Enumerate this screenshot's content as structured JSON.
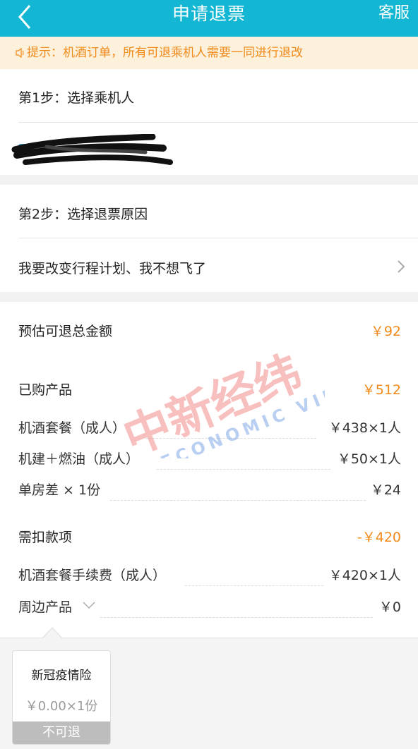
{
  "header": {
    "back_icon": "chevron-left-icon",
    "title": "申请退票",
    "service_label": "客服"
  },
  "notice": {
    "icon": "speaker-icon",
    "text": "提示：机酒订单，所有可退乘机人需要一同进行退改"
  },
  "step1": {
    "title": "第1步：选择乘机人"
  },
  "step2": {
    "title": "第2步：选择退票原因",
    "reason": "我要改变行程计划、我不想飞了",
    "chevron_icon": "chevron-right-icon"
  },
  "refund": {
    "total_label": "预估可退总金额",
    "total_value": "￥92",
    "purchased_label": "已购产品",
    "purchased_value": "￥512",
    "items": [
      {
        "label": "机酒套餐（成人）",
        "value": "￥438×1人"
      },
      {
        "label": "机建＋燃油（成人）",
        "value": "￥50×1人"
      },
      {
        "label": "单房差 × 1份",
        "value": "￥24"
      }
    ],
    "deduct_label": "需扣款项",
    "deduct_value": "-￥420",
    "deduct_items": [
      {
        "label": "机酒套餐手续费（成人）",
        "value": "￥420×1人"
      },
      {
        "label": "周边产品",
        "value": "￥0"
      }
    ]
  },
  "watermark": {
    "cn": "中新经纬",
    "en": "ECONOMIC VIEW"
  },
  "insurance": {
    "name": "新冠疫情险",
    "price": "￥0.00×1份",
    "status": "不可退"
  },
  "colors": {
    "header": "#13b7d3",
    "accent": "#f08a1a",
    "notice_bg": "#fdf1dc"
  }
}
